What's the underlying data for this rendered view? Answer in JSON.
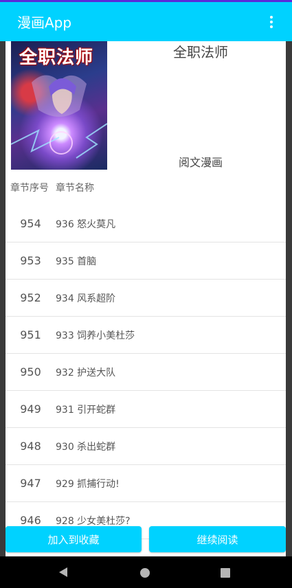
{
  "app": {
    "title": "漫画App"
  },
  "comic": {
    "cover_logo_text": "全职法师",
    "title": "全职法师",
    "source": "阅文漫画"
  },
  "table": {
    "header_no": "章节序号",
    "header_name": "章节名称",
    "chapters": [
      {
        "no": "954",
        "name": "936 怒火莫凡"
      },
      {
        "no": "953",
        "name": "935 首脑"
      },
      {
        "no": "952",
        "name": "934 风系超阶"
      },
      {
        "no": "951",
        "name": "933 饲养小美杜莎"
      },
      {
        "no": "950",
        "name": "932 护送大队"
      },
      {
        "no": "949",
        "name": "931 引开蛇群"
      },
      {
        "no": "948",
        "name": "930 杀出蛇群"
      },
      {
        "no": "947",
        "name": "929 抓捕行动!"
      },
      {
        "no": "946",
        "name": "928 少女美杜莎?"
      }
    ]
  },
  "actions": {
    "favorite_label": "加入到收藏",
    "continue_label": "继续阅读"
  },
  "colors": {
    "accent": "#00d2ff",
    "status_line": "#5b2bd9"
  },
  "icons": {
    "menu": "more-vert-icon",
    "back": "back-icon",
    "home": "home-icon",
    "recent": "recent-apps-icon"
  }
}
